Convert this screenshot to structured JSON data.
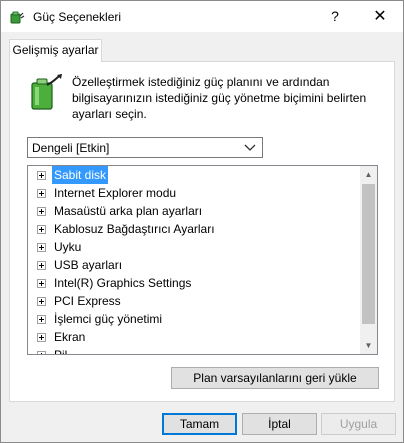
{
  "window": {
    "title": "Güç Seçenekleri",
    "help_label": "?",
    "close_label": "✕"
  },
  "tab": {
    "label": "Gelişmiş ayarlar"
  },
  "description": "Özelleştirmek istediğiniz güç planını ve ardından bilgisayarınızın istediğiniz güç yönetme biçimini belirten ayarları seçin.",
  "plan_select": {
    "value": "Dengeli [Etkin]"
  },
  "tree": {
    "items": [
      {
        "label": "Sabit disk",
        "selected": true
      },
      {
        "label": "Internet Explorer modu",
        "selected": false
      },
      {
        "label": "Masaüstü arka plan ayarları",
        "selected": false
      },
      {
        "label": "Kablosuz Bağdaştırıcı Ayarları",
        "selected": false
      },
      {
        "label": "Uyku",
        "selected": false
      },
      {
        "label": "USB ayarları",
        "selected": false
      },
      {
        "label": "Intel(R) Graphics Settings",
        "selected": false
      },
      {
        "label": "PCI Express",
        "selected": false
      },
      {
        "label": "İşlemci güç yönetimi",
        "selected": false
      },
      {
        "label": "Ekran",
        "selected": false
      },
      {
        "label": "Pil",
        "selected": false
      }
    ]
  },
  "buttons": {
    "restore": "Plan varsayılanlarını geri yükle",
    "ok": "Tamam",
    "cancel": "İptal",
    "apply": "Uygula"
  },
  "colors": {
    "selection": "#3399ff",
    "focus_border": "#0078d7"
  }
}
